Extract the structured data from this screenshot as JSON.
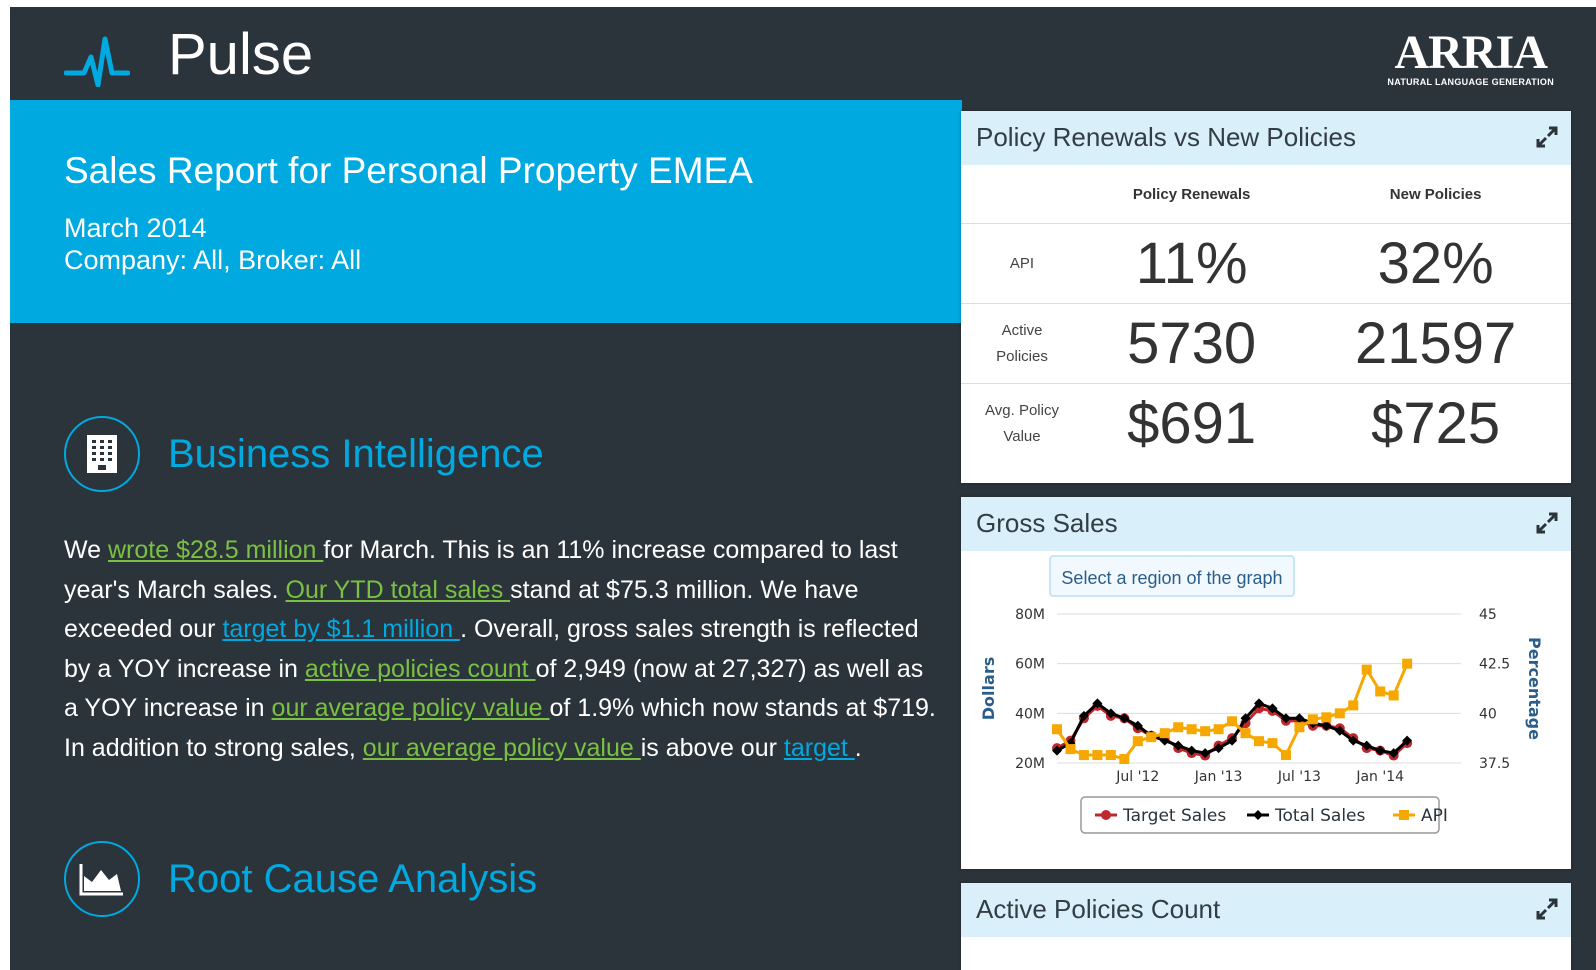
{
  "header": {
    "app_title": "Pulse",
    "brand_name": "ARRIA",
    "brand_tagline": "NATURAL LANGUAGE GENERATION"
  },
  "report": {
    "title": "Sales Report for Personal Property EMEA",
    "period": "March 2014",
    "filters": "Company: All, Broker: All"
  },
  "sections": {
    "business_intelligence": "Business Intelligence",
    "root_cause": "Root Cause Analysis"
  },
  "narrative": {
    "t1": "We ",
    "l1": "wrote $28.5 million ",
    "t2": "for March. This is an 11% increase compared to last year's March sales. ",
    "l2": "Our YTD total sales ",
    "t3": "stand at $75.3 million. We have exceeded our ",
    "l3": "target by $1.1 million ",
    "t4": ". Overall, gross sales strength is reflected by a YOY increase in ",
    "l4": "active policies count ",
    "t5": "of 2,949 (now at 27,327) as well as a YOY increase in ",
    "l5": "our average policy value ",
    "t6": "of 1.9% which now stands at $719. In addition to strong sales, ",
    "l6": "our average policy value ",
    "t7": "is above our ",
    "l7": "target ",
    "t8": "."
  },
  "policy_panel": {
    "title": "Policy Renewals vs New Policies",
    "columns": [
      "Policy Renewals",
      "New Policies"
    ],
    "rows": [
      {
        "label_1": "API",
        "label_2": "",
        "renewals": "11%",
        "new": "32%"
      },
      {
        "label_1": "Active",
        "label_2": "Policies",
        "renewals": "5730",
        "new": "21597"
      },
      {
        "label_1": "Avg. Policy",
        "label_2": "Value",
        "renewals": "$691",
        "new": "$725"
      }
    ]
  },
  "gross_panel": {
    "title": "Gross Sales",
    "hint": "Select a region of the graph"
  },
  "active_panel": {
    "title": "Active Policies Count"
  },
  "colors": {
    "accent": "#00a9e0",
    "link_green": "#7ac143",
    "dark_bg": "#2b333b",
    "panel_head": "#d9f0fb",
    "target": "#c0272d",
    "total": "#000000",
    "api": "#f7a800"
  },
  "chart_data": {
    "type": "line",
    "title": "",
    "ylabel": "Dollars",
    "y2label": "Percentage",
    "ylim": [
      20,
      80
    ],
    "y_ticks": [
      "20M",
      "40M",
      "60M",
      "80M"
    ],
    "y2lim": [
      37.5,
      45
    ],
    "y2_ticks": [
      "37.5",
      "40",
      "42.5",
      "45"
    ],
    "x_ticks": [
      {
        "label": "Jul '12",
        "x": 6
      },
      {
        "label": "Jan '13",
        "x": 12
      },
      {
        "label": "Jul '13",
        "x": 18
      },
      {
        "label": "Jan '14",
        "x": 24
      }
    ],
    "x": [
      0,
      1,
      2,
      3,
      4,
      5,
      6,
      7,
      8,
      9,
      10,
      11,
      12,
      13,
      14,
      15,
      16,
      17,
      18,
      19,
      20,
      21,
      22,
      23,
      24,
      25,
      26,
      27,
      28,
      29,
      30
    ],
    "grid": true,
    "legend_position": "bottom",
    "legend": [
      "Target Sales",
      "Total Sales",
      "API"
    ],
    "series": [
      {
        "name": "Target Sales",
        "axis": "left",
        "color": "#c0272d",
        "marker": "circle",
        "values": [
          26,
          29,
          38,
          43,
          39,
          38,
          34,
          31,
          30,
          26,
          24,
          23,
          27,
          30,
          36,
          42,
          41,
          37,
          37,
          35,
          35,
          34,
          30,
          26,
          25,
          23,
          28,
          null,
          null,
          null,
          null
        ]
      },
      {
        "name": "Total Sales",
        "axis": "left",
        "color": "#000000",
        "marker": "diamond",
        "values": [
          25,
          28,
          39,
          44,
          40,
          38,
          35,
          31,
          29,
          27,
          25,
          24,
          26,
          29,
          38,
          44,
          42,
          38,
          38,
          36,
          35,
          33,
          29,
          27,
          25,
          24,
          29,
          null,
          null,
          null,
          null
        ]
      },
      {
        "name": "API",
        "axis": "right",
        "color": "#f7a800",
        "marker": "square",
        "values": [
          39.2,
          38.2,
          37.9,
          37.9,
          37.9,
          37.7,
          38.6,
          38.8,
          39.0,
          39.3,
          39.2,
          39.1,
          39.2,
          39.6,
          39.0,
          38.6,
          38.5,
          37.9,
          39.3,
          39.7,
          39.8,
          40.0,
          40.4,
          42.2,
          41.1,
          40.9,
          42.5,
          null,
          null,
          null,
          null
        ]
      }
    ]
  }
}
